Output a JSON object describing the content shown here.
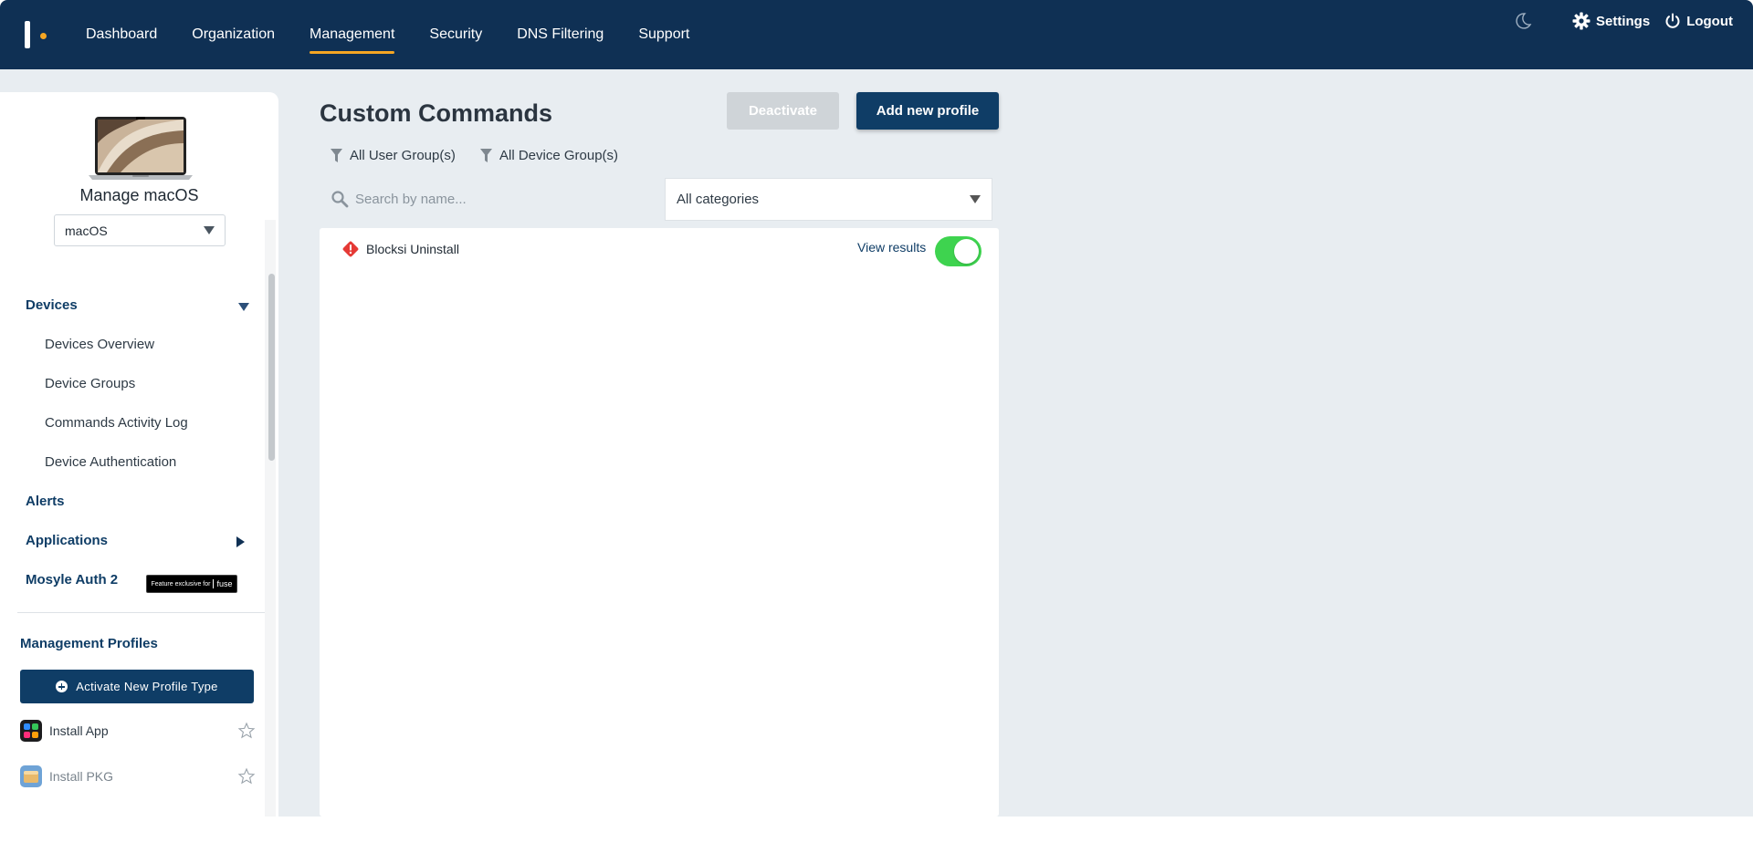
{
  "nav": {
    "items": [
      {
        "label": "Dashboard",
        "active": false
      },
      {
        "label": "Organization",
        "active": false
      },
      {
        "label": "Management",
        "active": true
      },
      {
        "label": "Security",
        "active": false
      },
      {
        "label": "DNS Filtering",
        "active": false
      },
      {
        "label": "Support",
        "active": false
      }
    ],
    "settings_label": "Settings",
    "logout_label": "Logout",
    "theme_icon": "moon-icon"
  },
  "colors": {
    "brand": "#0f3054",
    "accent": "#f5a623",
    "toggle_on": "#3ed34f",
    "alert": "#e53935"
  },
  "sidebar": {
    "manage_title": "Manage macOS",
    "os_select_value": "macOS",
    "sections": {
      "devices": {
        "label": "Devices",
        "expanded": true,
        "items": [
          "Devices Overview",
          "Device Groups",
          "Commands Activity Log",
          "Device Authentication"
        ]
      },
      "alerts": {
        "label": "Alerts"
      },
      "applications": {
        "label": "Applications",
        "expanded": false
      },
      "mosyle_auth": {
        "label": "Mosyle Auth 2",
        "badge": "Feature exclusive for",
        "badge_brand": "fuse"
      }
    },
    "profiles_title": "Management Profiles",
    "activate_button": "Activate New Profile Type",
    "profiles": [
      {
        "label": "Install App",
        "icon": "install-app-icon",
        "favorite": false
      },
      {
        "label": "Install PKG",
        "icon": "install-pkg-icon",
        "favorite": false
      }
    ]
  },
  "main": {
    "title": "Custom Commands",
    "deactivate_label": "Deactivate",
    "add_label": "Add new profile",
    "filters": {
      "user_groups": "All User Group(s)",
      "device_groups": "All Device Group(s)"
    },
    "search": {
      "placeholder": "Search by name...",
      "value": ""
    },
    "category_select": "All categories",
    "rows": [
      {
        "name": "Blocksi Uninstall",
        "status_icon": "warning-icon",
        "action": "View results",
        "enabled": true
      }
    ]
  }
}
